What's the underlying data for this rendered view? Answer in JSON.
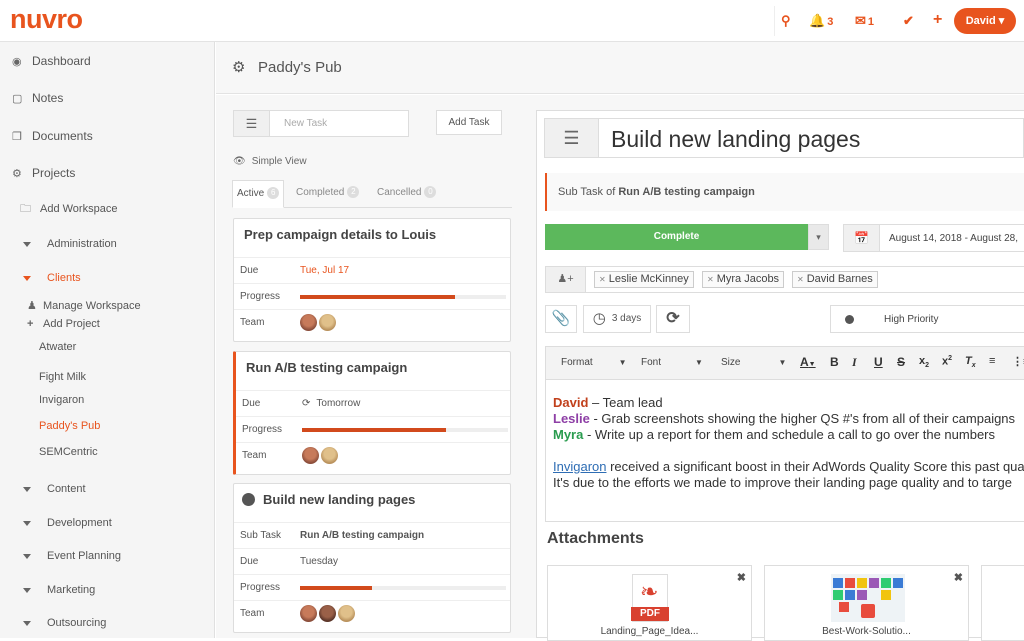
{
  "brand": {
    "logo": "nuvro",
    "accent": "#e8541e"
  },
  "topbar": {
    "notifications_count": "3",
    "messages_count": "1",
    "user_label": "David"
  },
  "sidebar": {
    "dashboard": "Dashboard",
    "notes": "Notes",
    "documents": "Documents",
    "projects": "Projects",
    "add_workspace": "Add Workspace",
    "administration": "Administration",
    "clients": "Clients",
    "manage_workspace": "Manage Workspace",
    "add_project": "Add Project",
    "client_items": [
      "Atwater",
      "Fight Milk",
      "Invigaron",
      "Paddy's Pub",
      "SEMCentric"
    ],
    "content": "Content",
    "development": "Development",
    "event_planning": "Event Planning",
    "marketing": "Marketing",
    "outsourcing": "Outsourcing"
  },
  "header": {
    "title": "Paddy's Pub"
  },
  "tasklist": {
    "new_task_placeholder": "New Task",
    "add_task": "Add Task",
    "simple_view": "Simple View",
    "tabs": [
      {
        "label": "Active",
        "count": "6"
      },
      {
        "label": "Completed",
        "count": "2"
      },
      {
        "label": "Cancelled",
        "count": "0"
      }
    ],
    "labels": {
      "due": "Due",
      "progress": "Progress",
      "team": "Team",
      "sub_task": "Sub Task"
    },
    "cards": [
      {
        "title": "Prep campaign details to Louis",
        "due": "Tue, Jul 17",
        "progress": 0.75
      },
      {
        "title": "Run A/B testing campaign",
        "due": "Tomorrow",
        "progress": 0.7
      },
      {
        "title": "Build new landing pages",
        "sub_task": "Run A/B testing campaign",
        "due": "Tuesday",
        "progress": 0.35
      }
    ]
  },
  "detail": {
    "title": "Build new landing pages",
    "subtask_prefix": "Sub Task of ",
    "subtask_parent": "Run A/B testing campaign",
    "complete_label": "Complete",
    "date_range": "August 14, 2018 - August 28,",
    "assignees": [
      "Leslie McKinney",
      "Myra Jacobs",
      "David Barnes"
    ],
    "duration": "3 days",
    "priority": "High Priority",
    "toolbar": {
      "format": "Format",
      "font": "Font",
      "size": "Size"
    },
    "body": {
      "l1_name": "David",
      "l1_text": " – Team lead",
      "l2_name": "Leslie",
      "l2_text": " - Grab screenshots showing the higher QS #'s from all of their campaigns",
      "l3_name": "Myra",
      "l3_text": " - Write up a report for them and schedule a call to go over the numbers",
      "l4_link": "Invigaron",
      "l4_text": " received a significant boost in their AdWords Quality Score this past qua",
      "l5_text": "It's due to the efforts we made to improve their landing page quality and to targe"
    },
    "attachments_heading": "Attachments",
    "attachments": [
      "Landing_Page_Idea...",
      "Best-Work-Solutio..."
    ]
  }
}
